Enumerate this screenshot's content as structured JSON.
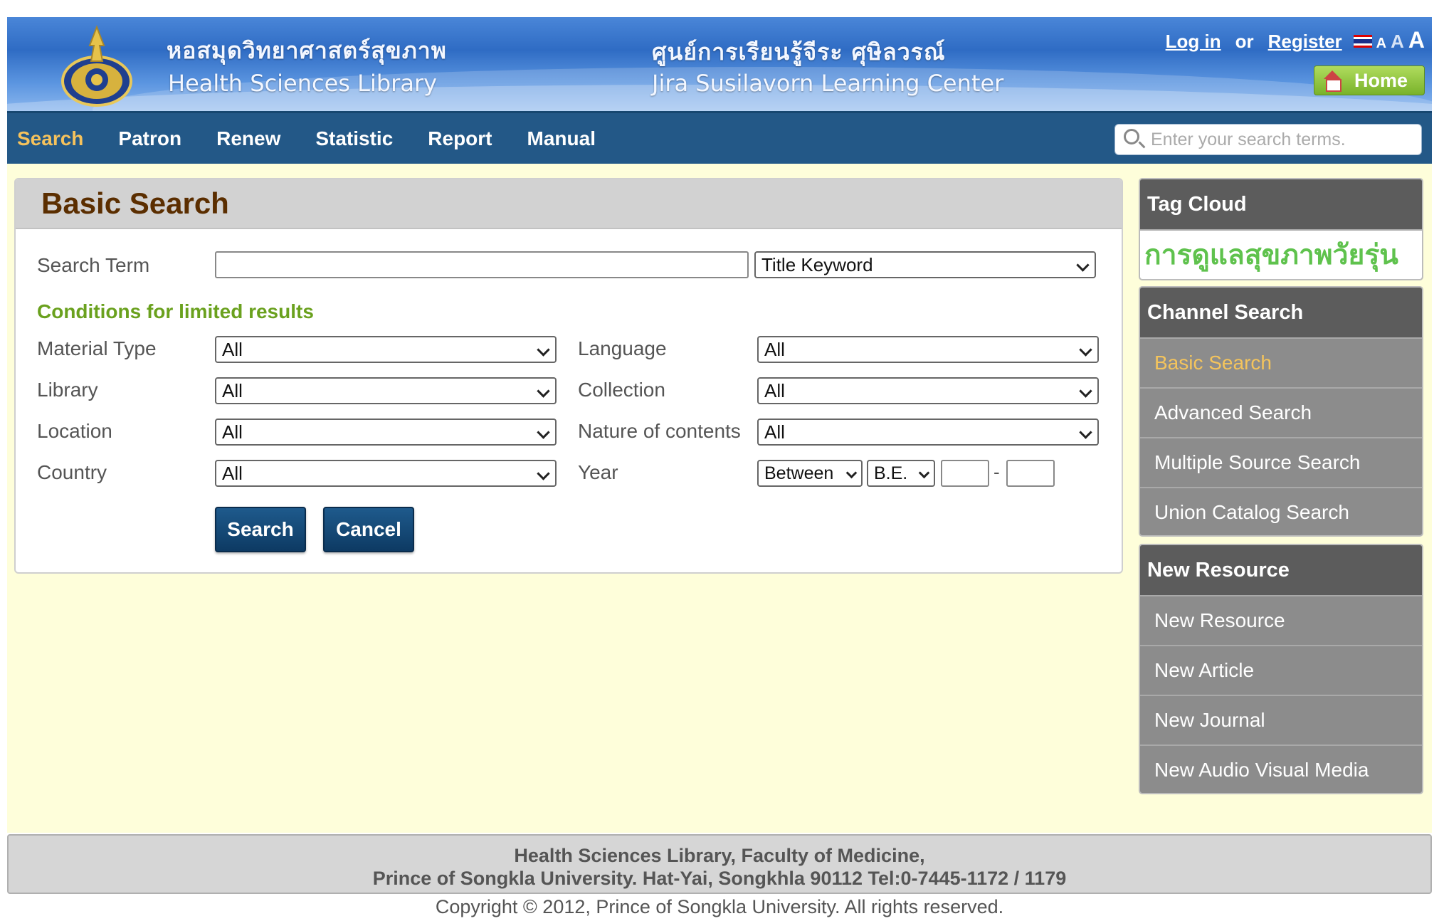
{
  "header": {
    "left_thai": "หอสมุดวิทยาศาสตร์สุขภาพ",
    "left_english": "Health Sciences Library",
    "center_thai": "ศูนย์การเรียนรู้จีระ ศุษิลวรณ์",
    "center_english": "Jira Susilavorn Learning Center",
    "login_label": "Log in",
    "or_label": "or",
    "register_label": "Register",
    "font_small": "A",
    "font_medium": "A",
    "font_large": "A",
    "home_label": "Home"
  },
  "nav": {
    "items": [
      "Search",
      "Patron",
      "Renew",
      "Statistic",
      "Report",
      "Manual"
    ],
    "active": "Search",
    "search_placeholder": "Enter your search terms."
  },
  "basic_search": {
    "title": "Basic Search",
    "search_term_label": "Search Term",
    "search_term_value": "",
    "search_field_selected": "Title Keyword",
    "conditions_title": "Conditions for limited results",
    "material_type_label": "Material Type",
    "material_type_value": "All",
    "library_label": "Library",
    "library_value": "All",
    "location_label": "Location",
    "location_value": "All",
    "country_label": "Country",
    "country_value": "All",
    "language_label": "Language",
    "language_value": "All",
    "collection_label": "Collection",
    "collection_value": "All",
    "nature_label": "Nature of contents",
    "nature_value": "All",
    "year_label": "Year",
    "year_mode": "Between",
    "year_era": "B.E.",
    "year_separator": "-",
    "search_button": "Search",
    "cancel_button": "Cancel"
  },
  "sidebar": {
    "tag_cloud": {
      "title": "Tag Cloud",
      "tags": [
        "การดูแลสุขภาพวัยรุ่น"
      ]
    },
    "channel_search": {
      "title": "Channel Search",
      "items": [
        "Basic Search",
        "Advanced Search",
        "Multiple Source Search",
        "Union Catalog Search"
      ],
      "active": "Basic Search"
    },
    "new_resource": {
      "title": "New Resource",
      "items": [
        "New Resource",
        "New Article",
        "New Journal",
        "New Audio Visual Media"
      ]
    }
  },
  "footer": {
    "line1": "Health Sciences Library, Faculty of Medicine,",
    "line2": "Prince of Songkla University. Hat-Yai, Songkhla 90112 Tel:0-7445-1172 / 1179",
    "copyright": "Copyright © 2012, Prince of Songkla University. All rights reserved."
  },
  "colors": {
    "nav_bg": "#235887",
    "nav_active": "#f5c25c",
    "title_brown": "#5b2e00",
    "condition_green": "#6aa11e",
    "tag_green": "#5fc24d",
    "page_bg": "#fefeda"
  }
}
